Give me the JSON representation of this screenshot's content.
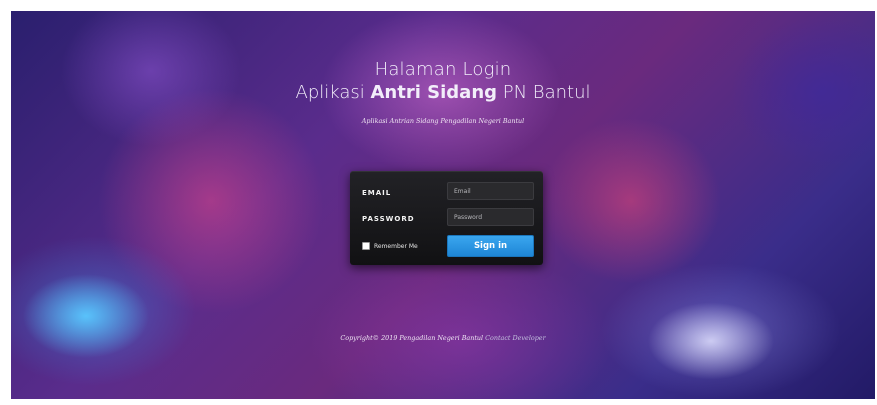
{
  "header": {
    "line1": "Halaman Login",
    "line2_prefix": "Aplikasi",
    "line2_bold": "Antri Sidang",
    "line2_suffix": "PN Bantul",
    "tagline": "Aplikasi Antrian Sidang Pengadilan Negeri Bantul"
  },
  "login": {
    "email_label": "EMAIL",
    "email_placeholder": "Email",
    "email_value": "",
    "password_label": "PASSWORD",
    "password_placeholder": "Password",
    "password_value": "",
    "remember_label": "Remember Me",
    "remember_checked": false,
    "signin_label": "Sign in"
  },
  "footer": {
    "copyright": "Copyright© 2019 Pengadilan Negeri Bantul",
    "contact_link": "Contact Developer"
  },
  "colors": {
    "signin_button": "#2a96e4",
    "panel": "#19191b",
    "background_primary": "#4a2a86"
  }
}
